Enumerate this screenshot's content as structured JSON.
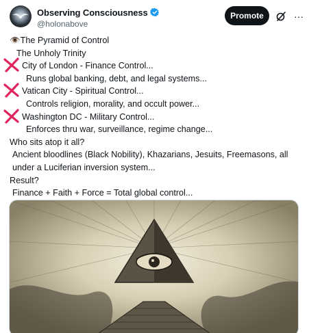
{
  "post": {
    "author_name": "Observing Consciousness",
    "handle": "@holonabove",
    "promote_label": "Promote",
    "more_label": "···",
    "lines": [
      "👁️The Pyramid of Control",
      "The Unholy Trinity",
      "City of London - Finance Control...",
      "Runs global banking, debt, and legal systems...",
      "Vatican City - Spiritual Control...",
      "Controls religion, morality, and occult power...",
      "Washington DC - Military Control...",
      "Enforces thru war, surveillance, regime change...",
      "Who sits atop it all?",
      "Ancient bloodlines (Black Nobility), Khazarians, Jesuits, Freemasons, all under a Luciferian inversion system...",
      "Result?",
      "Finance + Faith + Force = Total global control..."
    ]
  },
  "colors": {
    "verified": "#1d9bf0",
    "cross": "#e0245e",
    "promote_bg": "#0f1419"
  },
  "icons": [
    "verified-badge-icon",
    "grok-icon",
    "more-icon",
    "cross-mark-icon"
  ]
}
